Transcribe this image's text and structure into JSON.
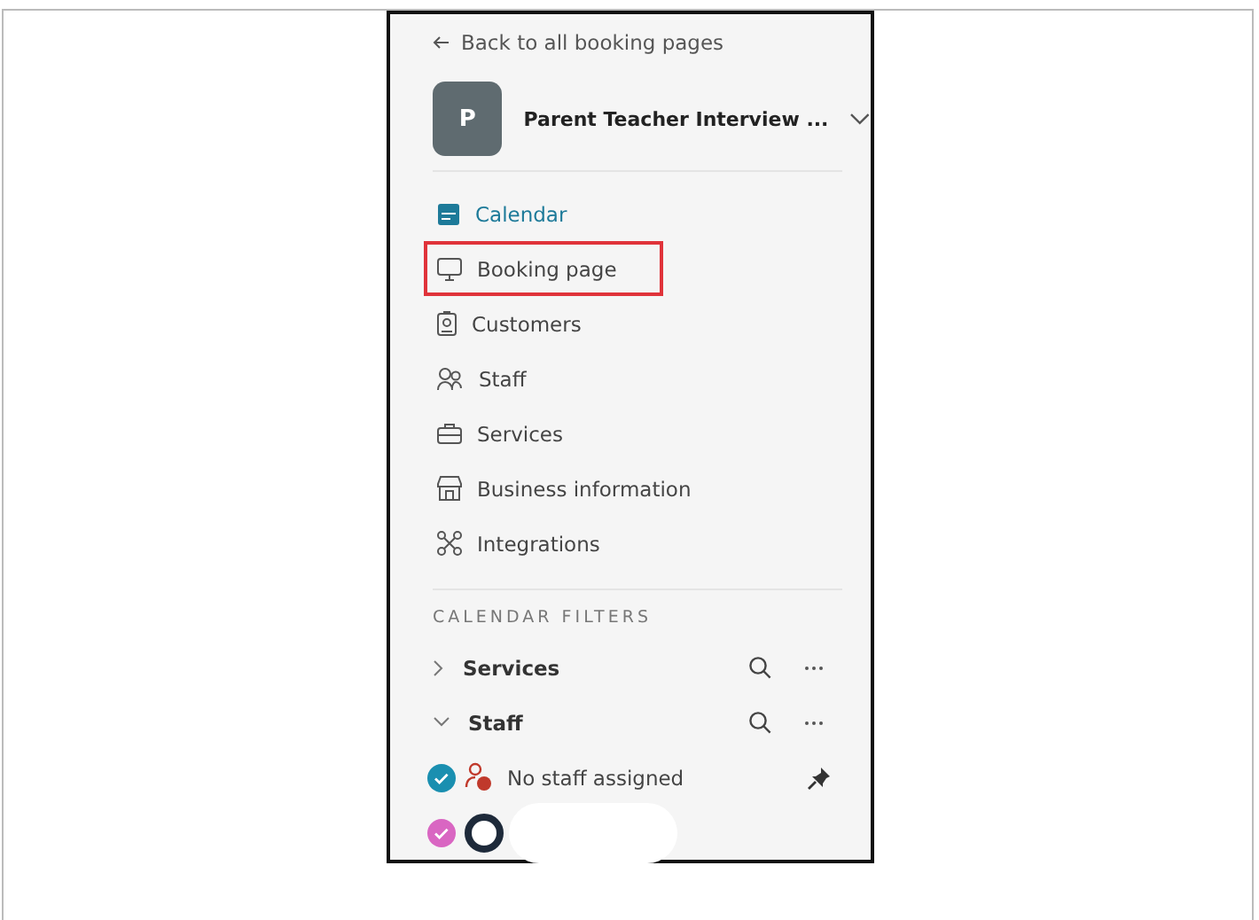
{
  "back_link": "Back to all booking pages",
  "header": {
    "avatar": "P",
    "title": "Parent Teacher Interview ..."
  },
  "nav": [
    {
      "label": "Calendar",
      "selected": true,
      "highlighted": false
    },
    {
      "label": "Booking page",
      "selected": false,
      "highlighted": true
    },
    {
      "label": "Customers",
      "selected": false,
      "highlighted": false
    },
    {
      "label": "Staff",
      "selected": false,
      "highlighted": false
    },
    {
      "label": "Services",
      "selected": false,
      "highlighted": false
    },
    {
      "label": "Business information",
      "selected": false,
      "highlighted": false
    },
    {
      "label": "Integrations",
      "selected": false,
      "highlighted": false
    }
  ],
  "filters_heading": "CALENDAR FILTERS",
  "filters": [
    {
      "label": "Services",
      "expanded": false
    },
    {
      "label": "Staff",
      "expanded": true
    }
  ],
  "staff": [
    {
      "name": "No staff assigned",
      "checked": true,
      "color": "#1a8fb0",
      "pinned": true
    },
    {
      "checked": true,
      "color": "#d966c2",
      "pinned": false
    }
  ]
}
